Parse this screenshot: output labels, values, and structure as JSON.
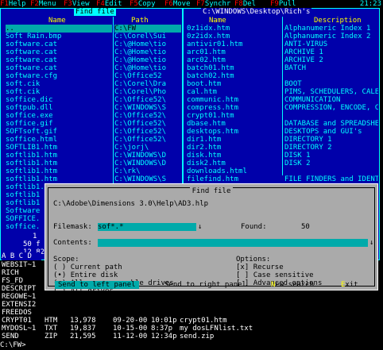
{
  "keybar": [
    {
      "n": "F1",
      "t": "Help"
    },
    {
      "n": "F2",
      "t": "Menu"
    },
    {
      "n": "F3",
      "t": "View"
    },
    {
      "n": "F4",
      "t": "Edit"
    },
    {
      "n": "F5",
      "t": "Copy"
    },
    {
      "n": "F6",
      "t": "Move"
    },
    {
      "n": "F7",
      "t": "Synchr"
    },
    {
      "n": "F8",
      "t": "Del"
    },
    {
      "n": "F9",
      "t": "Pull"
    }
  ],
  "clock": "21:23",
  "left_panel": {
    "title": "Find file",
    "col_name": "Name",
    "col_path": "Path",
    "rows": [
      {
        "name": "..",
        "path": "C:\\FW"
      },
      {
        "name": "Soft Rain.bmp",
        "path": "C:\\Corel\\Sui"
      },
      {
        "name": "software.cat",
        "path": "C:\\@Home\\tio"
      },
      {
        "name": "software.cat",
        "path": "C:\\@Home\\tio"
      },
      {
        "name": "software.cat",
        "path": "C:\\@Home\\tio"
      },
      {
        "name": "software.cat",
        "path": "C:\\@Home\\tio"
      },
      {
        "name": "software.cfg",
        "path": "C:\\Office52"
      },
      {
        "name": "soft.cik",
        "path": "C:\\Corel\\Dra"
      },
      {
        "name": "soft.cik",
        "path": "C:\\Corel\\Pho"
      },
      {
        "name": "soffice.dic",
        "path": "C:\\Office52\\"
      },
      {
        "name": "softpub.dll",
        "path": "C:\\WINDOWS\\S"
      },
      {
        "name": "soffice.exe",
        "path": "C:\\Office52\\"
      },
      {
        "name": "soffice.gif",
        "path": "C:\\Office52\\"
      },
      {
        "name": "SOFTsoft.gif",
        "path": "C:\\Office52\\"
      },
      {
        "name": "soffice.html",
        "path": "C:\\Office52\\"
      },
      {
        "name": "SOFTLIB1.htm",
        "path": "C:\\jorj\\"
      },
      {
        "name": "softlib1.htm",
        "path": "C:\\WINDOWS\\D"
      },
      {
        "name": "softlib1.htm",
        "path": "C:\\WINDOWS\\D"
      },
      {
        "name": "softlib1.htm",
        "path": "C:\\rk\\"
      },
      {
        "name": "softlib1.htm",
        "path": "C:\\WINDOWS\\S"
      },
      {
        "name": "softlib1.htm",
        "path": "C:\\WINDOWS\\S"
      }
    ],
    "extra_rows": [
      "softlib1",
      "softlib1",
      "Software",
      "SOFFICE.",
      "soffice."
    ],
    "info_line1": "1",
    "info_line2": "50 f",
    "info_line3": "12,82",
    "drives": "A B C D"
  },
  "right_panel": {
    "title": "C:\\WINDOWS\\Desktop\\Rich's",
    "col_name": "Name",
    "col_desc": "Description",
    "rows": [
      {
        "name": "0z1idx.htm",
        "desc": "Alphanumeric Index 1"
      },
      {
        "name": "0z2idx.htm",
        "desc": "Alphanumeric Index 2"
      },
      {
        "name": "antivir01.htm",
        "desc": "ANTI-VIRUS"
      },
      {
        "name": "arc01.htm",
        "desc": "ARCHIVE 1"
      },
      {
        "name": "arc02.htm",
        "desc": "ARCHIVE 2"
      },
      {
        "name": "batch01.htm",
        "desc": "BATCH"
      },
      {
        "name": "batch02.htm",
        "desc": ""
      },
      {
        "name": "boot.htm",
        "desc": "BOOT"
      },
      {
        "name": "cal.htm",
        "desc": "PIMS, SCHEDULERS, CALEND"
      },
      {
        "name": "communic.htm",
        "desc": "COMMUNICATION"
      },
      {
        "name": "compress.htm",
        "desc": "COMPRESSION, ENCODE, CRY"
      },
      {
        "name": "crypt01.htm",
        "desc": ""
      },
      {
        "name": "dbase.htm",
        "desc": "DATABASE and SPREADSHEET"
      },
      {
        "name": "desktops.htm",
        "desc": "DESKTOPS and GUI's"
      },
      {
        "name": "dir1.htm",
        "desc": "DIRECTORY 1"
      },
      {
        "name": "dir2.htm",
        "desc": "DIRECTORY 2"
      },
      {
        "name": "disk.htm",
        "desc": "DISK 1"
      },
      {
        "name": "disk2.htm",
        "desc": "DISK 2"
      },
      {
        "name": "downloads.html",
        "desc": ""
      },
      {
        "name": "filefind.htm",
        "desc": "FILE FINDERS and IDENTIF"
      }
    ]
  },
  "dialog": {
    "title": "Find file",
    "path": "C:\\Adobe\\Dimensions 3.0\\Help\\AD3.hlp",
    "filemask_label": "Filemask:",
    "filemask_value": "sof*.*",
    "found_label": "Found:",
    "found_value": "50",
    "contents_label": "Contents:",
    "contents_value": "",
    "scope_label": "Scope:",
    "scope_options": [
      {
        "mark": "( )",
        "label": "Current path"
      },
      {
        "mark": "(•)",
        "label": "Entire disk"
      },
      {
        "mark": "( )",
        "label": "All non-removable drives"
      },
      {
        "mark": "( )",
        "label": "All drives"
      }
    ],
    "options_label": "Options:",
    "option_items": [
      {
        "mark": "[x]",
        "label": "Recurse"
      },
      {
        "mark": "[ ]",
        "label": "Case sensitive"
      },
      {
        "mark": "[ ]",
        "label": "Advanced options"
      }
    ],
    "btn_send_left": "Send to left panel",
    "btn_send_right": "Send to right panel",
    "btn_new_search": "New search",
    "btn_exit": "Exit"
  },
  "left_lower": [
    "WEBSIT~1",
    "RICH",
    "FS_FD",
    "DESCRIPT",
    "REGOWE~1",
    "EXTENSI2",
    "FREEDOS"
  ],
  "file_list": [
    {
      "name": "CRYPT01",
      "ext": "HTM",
      "size": "13,978",
      "date": "09-20-00",
      "time": "10:01p",
      "file": "crypt01.htm"
    },
    {
      "name": "MYDOSL~1",
      "ext": "TXT",
      "size": "19,837",
      "date": "10-15-00",
      "time": "8:37p",
      "file": "my dosLFNlist.txt"
    },
    {
      "name": "SEND",
      "ext": "ZIP",
      "size": "21,595",
      "date": "11-12-00",
      "time": "12:34p",
      "file": "send.zip"
    }
  ],
  "prompt": "C:\\FW>"
}
